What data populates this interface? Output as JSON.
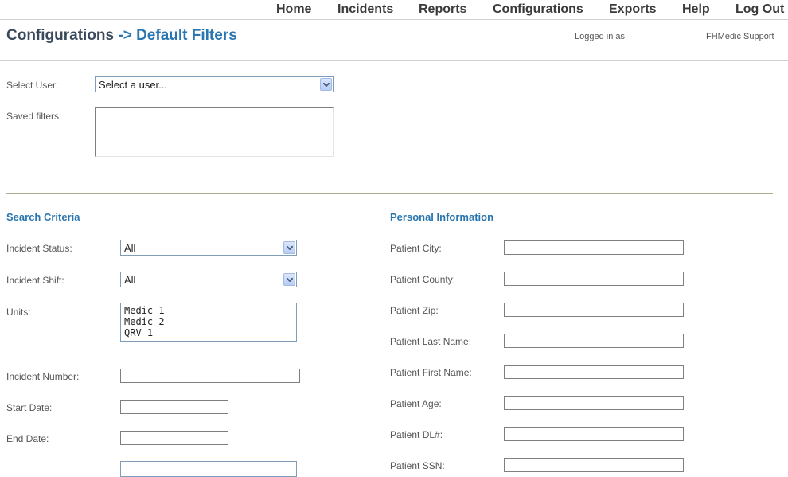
{
  "nav": {
    "items": [
      "Home",
      "Incidents",
      "Reports",
      "Configurations",
      "Exports",
      "Help",
      "Log Out"
    ]
  },
  "header": {
    "crumb_link": "Configurations",
    "crumb_rest": " -> Default Filters",
    "logged_in_label": "Logged in as",
    "user_name": "FHMedic Support"
  },
  "user_section": {
    "select_user_label": "Select User:",
    "select_user_value": "Select a user...",
    "saved_filters_label": "Saved filters:"
  },
  "search_criteria": {
    "title": "Search Criteria",
    "incident_status_label": "Incident Status:",
    "incident_status_value": "All",
    "incident_shift_label": "Incident Shift:",
    "incident_shift_value": "All",
    "units_label": "Units:",
    "units": [
      "Medic 1",
      "Medic 2",
      "QRV 1"
    ],
    "incident_number_label": "Incident Number:",
    "start_date_label": "Start Date:",
    "end_date_label": "End Date:"
  },
  "personal_info": {
    "title": "Personal Information",
    "fields": [
      "Patient City:",
      "Patient County:",
      "Patient Zip:",
      "Patient Last Name:",
      "Patient First Name:",
      "Patient Age:",
      "Patient DL#:",
      "Patient SSN:"
    ]
  }
}
